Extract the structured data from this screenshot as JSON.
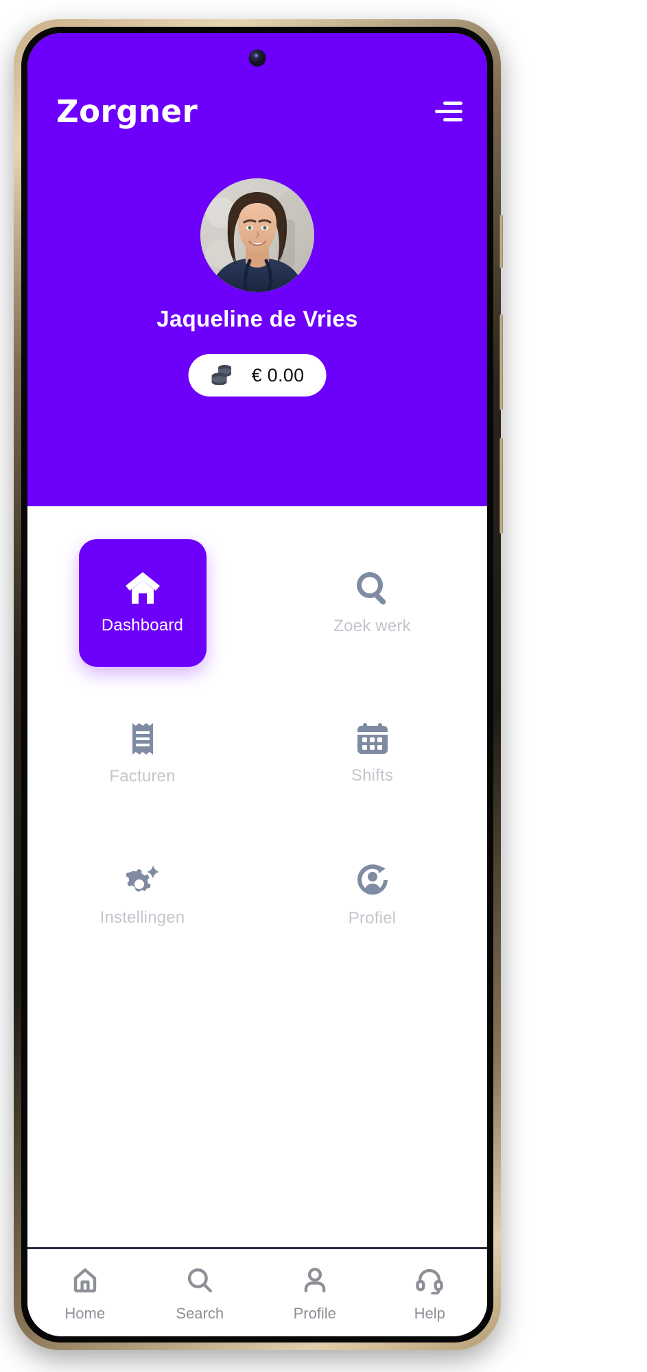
{
  "app": {
    "brand": "Zorgner",
    "menu_icon": "hamburger-icon",
    "brand_color": "#6d00fb",
    "idle_icon_color": "#7f8ba3",
    "idle_label_color": "#c3c6cc"
  },
  "profile": {
    "name": "Jaqueline de Vries",
    "avatar_alt": "nurse-portrait",
    "balance": {
      "icon": "coins-icon",
      "amount": "€ 0.00"
    }
  },
  "menu_grid": {
    "rows": [
      [
        {
          "label": "Dashboard",
          "icon": "home-icon",
          "active": true
        },
        {
          "label": "Zoek werk",
          "icon": "search-icon",
          "active": false
        }
      ],
      [
        {
          "label": "Facturen",
          "icon": "receipt-icon",
          "active": false
        },
        {
          "label": "Shifts",
          "icon": "calendar-icon",
          "active": false
        }
      ],
      [
        {
          "label": "Instellingen",
          "icon": "gear-sparkle-icon",
          "active": false
        },
        {
          "label": "Profiel",
          "icon": "profile-refresh-icon",
          "active": false
        }
      ]
    ]
  },
  "bottom_nav": {
    "items": [
      {
        "label": "Home",
        "icon": "home-outline-icon"
      },
      {
        "label": "Search",
        "icon": "search-outline-icon"
      },
      {
        "label": "Profile",
        "icon": "person-outline-icon"
      },
      {
        "label": "Help",
        "icon": "headset-icon"
      }
    ]
  }
}
